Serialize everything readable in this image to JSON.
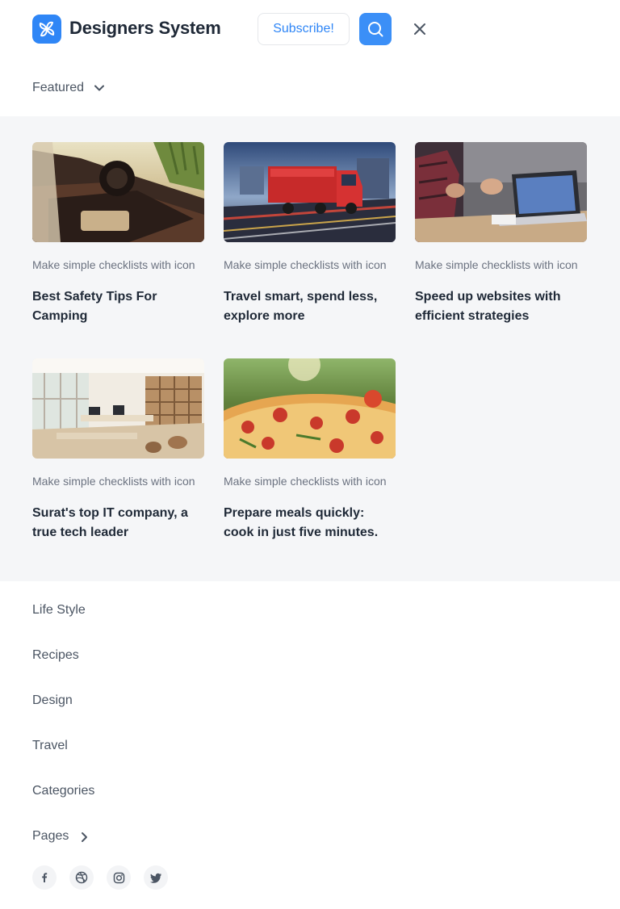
{
  "header": {
    "brand": "Designers System",
    "subscribe_label": "Subscribe!",
    "logo_icon": "pinwheel-icon",
    "search_icon": "search-icon",
    "close_icon": "close-icon",
    "accent_color": "#2f86f6"
  },
  "featured": {
    "label": "Featured",
    "icon": "chevron-down-icon"
  },
  "cards": [
    {
      "subtitle": "Make simple checklists with icon",
      "title": "Best Safety Tips For Camping",
      "image": "car-interior-photo"
    },
    {
      "subtitle": "Make simple checklists with icon",
      "title": "Travel smart, spend less, explore more",
      "image": "red-truck-photo"
    },
    {
      "subtitle": "Make simple checklists with icon",
      "title": "Speed up websites with efficient strategies",
      "image": "laptop-meeting-photo"
    },
    {
      "subtitle": "Make simple checklists with icon",
      "title": "Surat's top IT company, a true tech leader",
      "image": "office-interior-photo"
    },
    {
      "subtitle": "Make simple checklists with icon",
      "title": "Prepare meals quickly: cook in just five minutes.",
      "image": "pizza-photo"
    }
  ],
  "nav": {
    "items": [
      "Life Style",
      "Recipes",
      "Design",
      "Travel",
      "Categories",
      "Pages"
    ],
    "pages_icon": "chevron-right-icon"
  },
  "social": [
    "facebook-icon",
    "dribbble-icon",
    "instagram-icon",
    "twitter-icon"
  ]
}
